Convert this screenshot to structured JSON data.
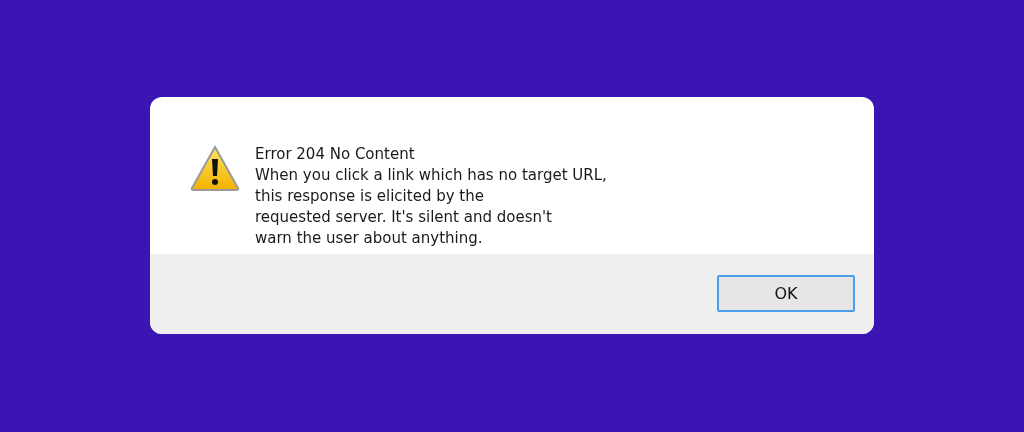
{
  "dialog": {
    "title": "Error 204 No Content",
    "message_lines": [
      "When you click a link which has no target URL,",
      "this response is elicited by the",
      "requested server. It's silent and doesn't",
      "warn the user about anything."
    ],
    "buttons": [
      {
        "label": "OK",
        "selected": true
      }
    ]
  }
}
